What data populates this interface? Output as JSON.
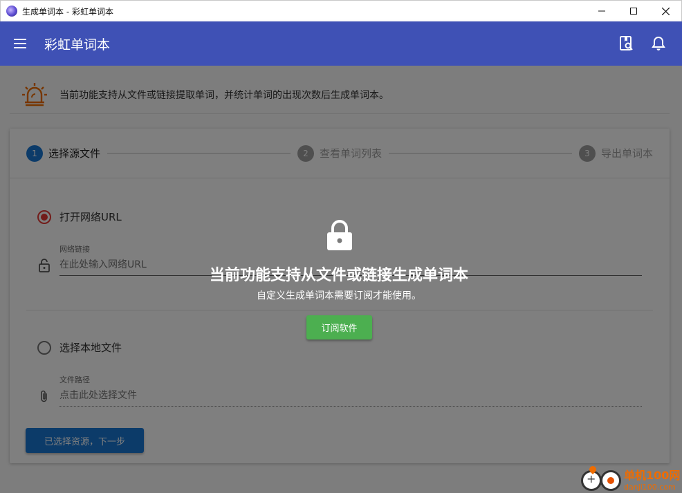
{
  "window": {
    "title": "生成单词本 - 彩虹单词本",
    "controls": {
      "minimize": "—",
      "maximize": "☐",
      "close": "✕"
    }
  },
  "appbar": {
    "title": "彩虹单词本",
    "color": "#3f51b5"
  },
  "notice": {
    "text": "当前功能支持从文件或链接提取单词，并统计单词的出现次数后生成单词本。"
  },
  "stepper": {
    "steps": [
      {
        "num": "1",
        "label": "选择源文件",
        "state": "active"
      },
      {
        "num": "2",
        "label": "查看单词列表",
        "state": "idle"
      },
      {
        "num": "3",
        "label": "导出单词本",
        "state": "idle"
      }
    ]
  },
  "form": {
    "url_option": {
      "label": "打开网络URL",
      "checked": true
    },
    "url_field": {
      "label": "网络链接",
      "placeholder": "在此处输入网络URL"
    },
    "file_option": {
      "label": "选择本地文件",
      "checked": false
    },
    "file_field": {
      "label": "文件路径",
      "placeholder": "点击此处选择文件"
    },
    "next_button": "已选择资源，下一步"
  },
  "overlay": {
    "title": "当前功能支持从文件或链接生成单词本",
    "subtitle": "自定义生成单词本需要订阅才能使用。",
    "button": "订阅软件"
  },
  "watermark": {
    "brand": "单机100网",
    "url": "danji100.com"
  },
  "colors": {
    "primary": "#3f51b5",
    "accent_blue": "#1976d2",
    "radio_red": "#e53935",
    "subscribe_green": "#4caf50"
  }
}
